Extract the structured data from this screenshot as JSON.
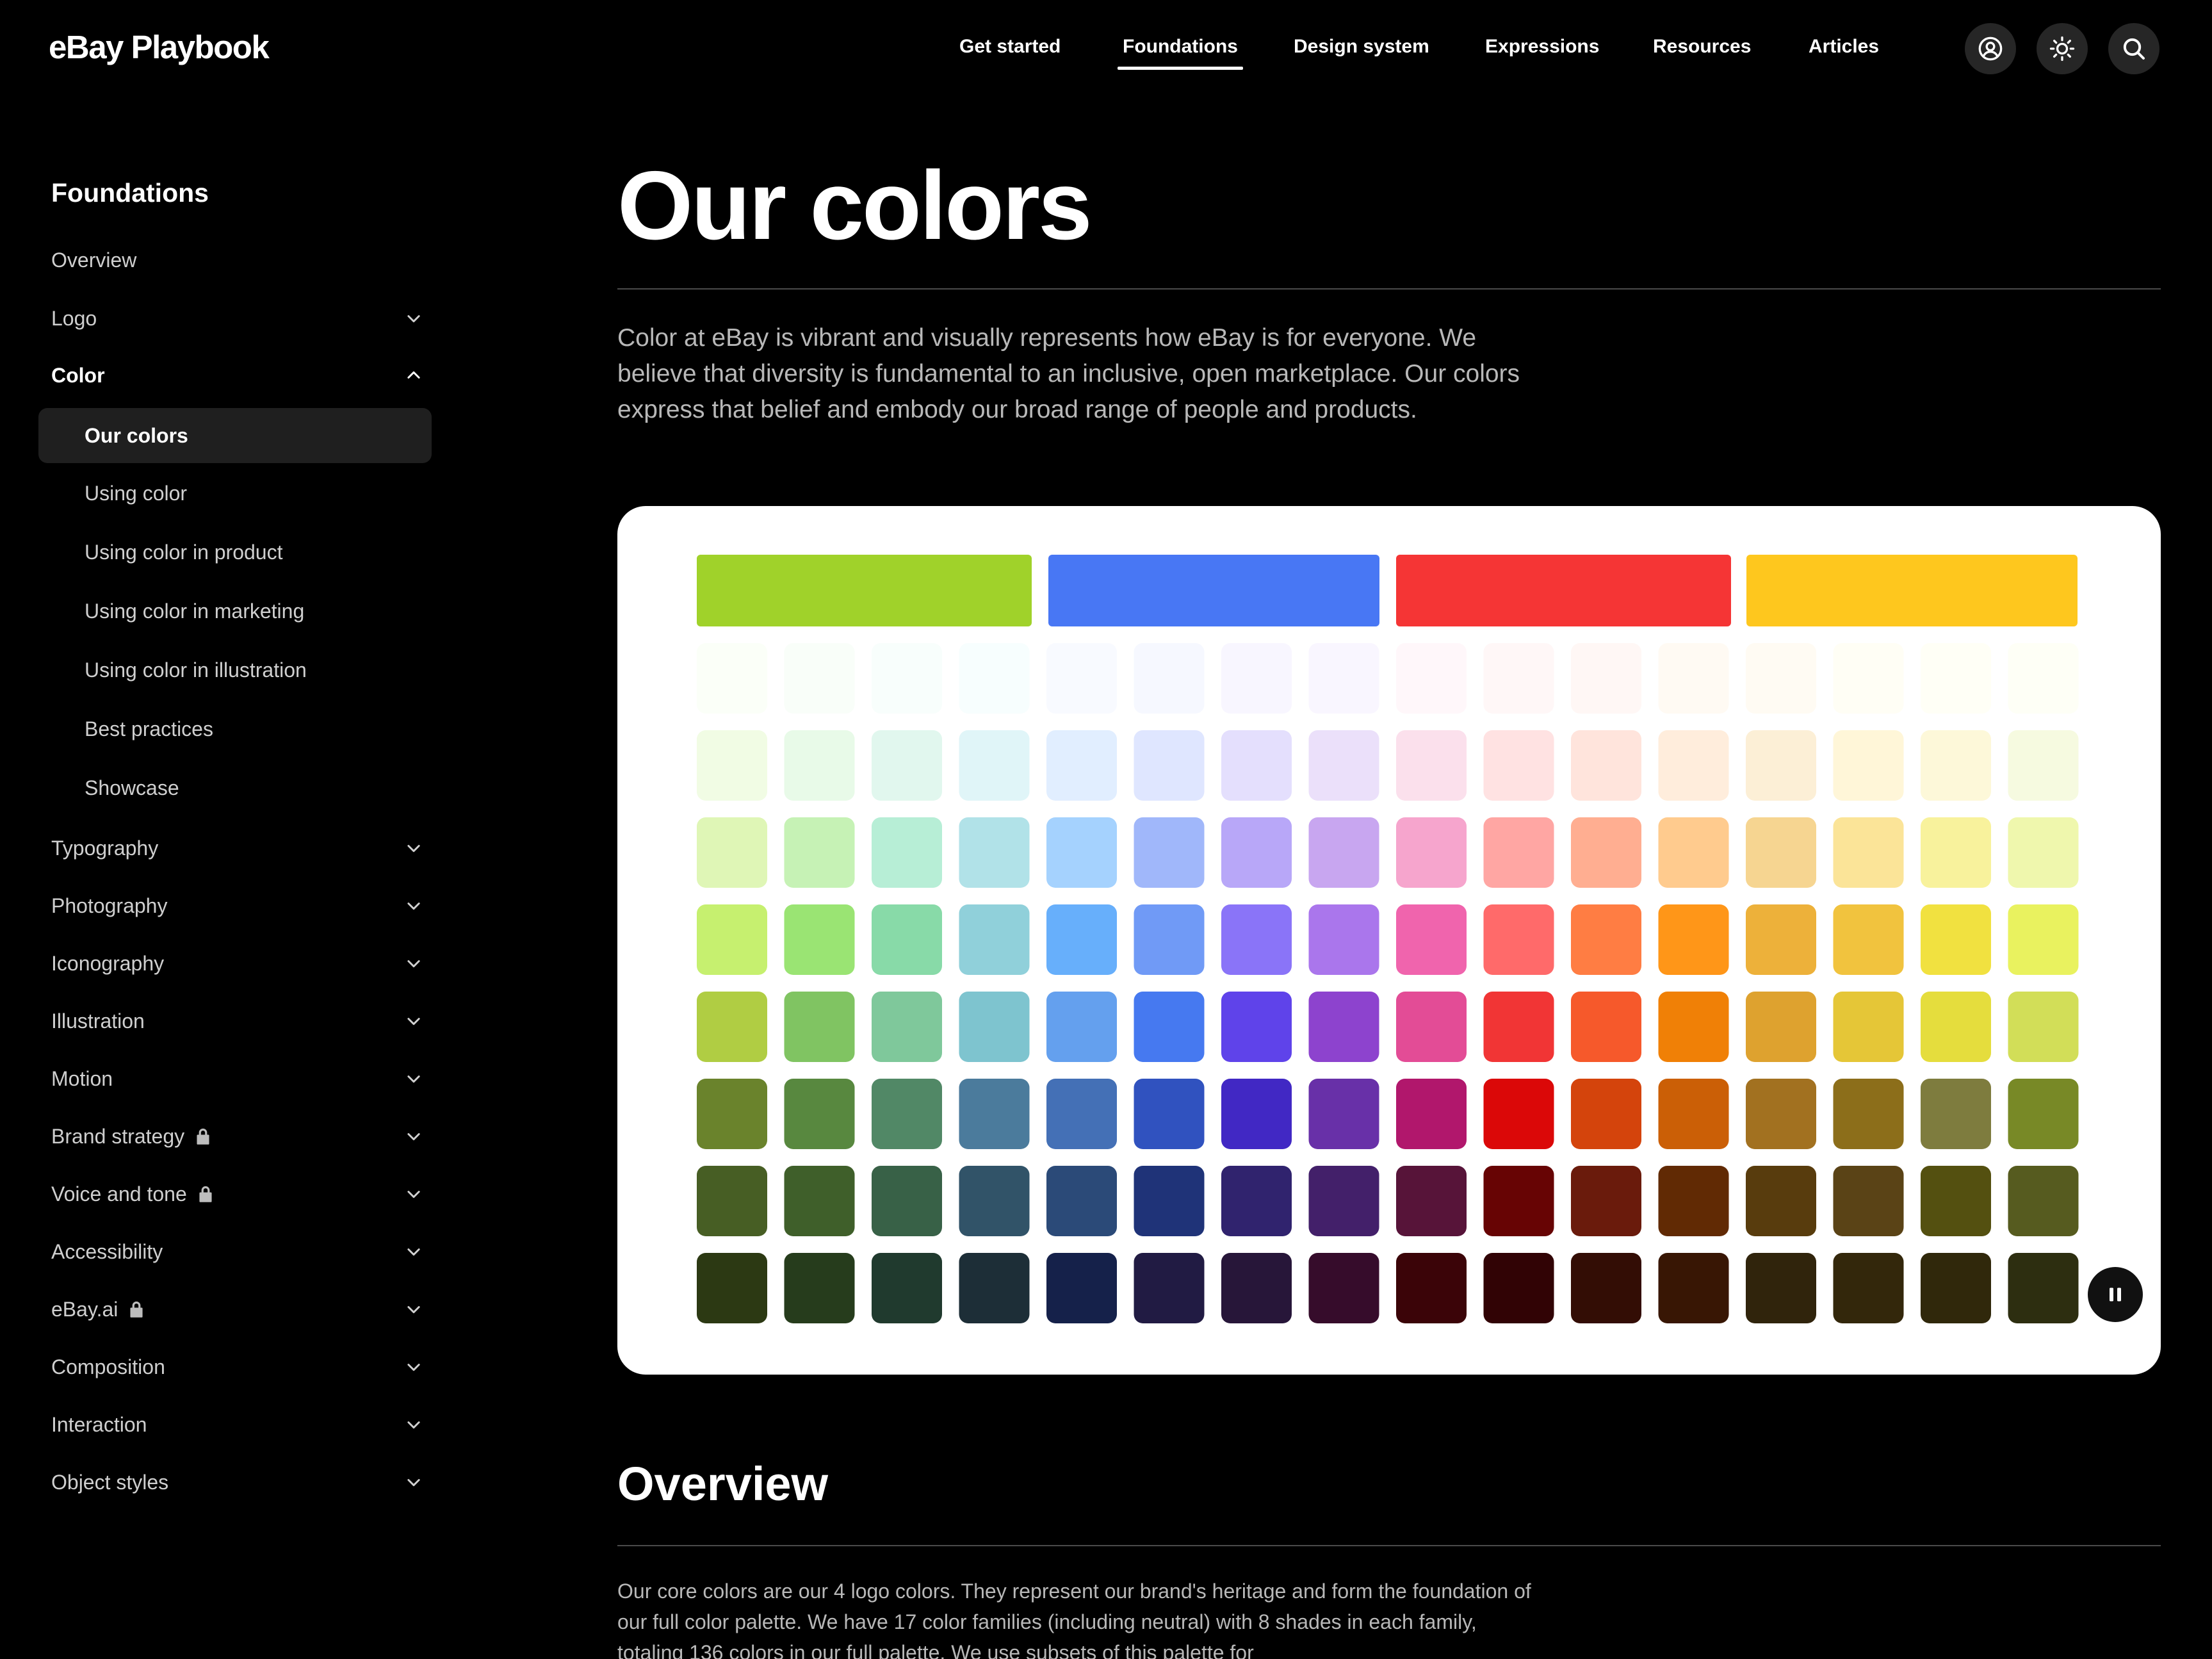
{
  "header": {
    "logo": "eBay Playbook",
    "nav": [
      {
        "label": "Get started",
        "active": false
      },
      {
        "label": "Foundations",
        "active": true
      },
      {
        "label": "Design system",
        "active": false
      },
      {
        "label": "Expressions",
        "active": false
      },
      {
        "label": "Resources",
        "active": false
      },
      {
        "label": "Articles",
        "active": false
      }
    ],
    "icons": [
      "user-icon",
      "sun-icon",
      "search-icon"
    ]
  },
  "sidebar": {
    "title": "Foundations",
    "items": [
      {
        "label": "Overview"
      },
      {
        "label": "Logo",
        "chevron": "down"
      },
      {
        "label": "Color",
        "chevron": "up",
        "expanded": true
      },
      {
        "label": "Typography",
        "chevron": "down"
      },
      {
        "label": "Photography",
        "chevron": "down"
      },
      {
        "label": "Iconography",
        "chevron": "down"
      },
      {
        "label": "Illustration",
        "chevron": "down"
      },
      {
        "label": "Motion",
        "chevron": "down"
      },
      {
        "label": "Brand strategy",
        "chevron": "down",
        "locked": true
      },
      {
        "label": "Voice and tone",
        "chevron": "down",
        "locked": true
      },
      {
        "label": "Accessibility",
        "chevron": "down"
      },
      {
        "label": "eBay.ai",
        "chevron": "down",
        "locked": true
      },
      {
        "label": "Composition",
        "chevron": "down"
      },
      {
        "label": "Interaction",
        "chevron": "down"
      },
      {
        "label": "Object styles",
        "chevron": "down"
      }
    ],
    "color_subitems": [
      {
        "label": "Our colors",
        "active": true
      },
      {
        "label": "Using color"
      },
      {
        "label": "Using color in product"
      },
      {
        "label": "Using color in marketing"
      },
      {
        "label": "Using color in illustration"
      },
      {
        "label": "Best practices"
      },
      {
        "label": "Showcase"
      }
    ]
  },
  "main": {
    "title": "Our colors",
    "intro": "Color at eBay is vibrant and visually represents how eBay is for everyone. We believe that diversity is fundamental to an inclusive, open marketplace. Our colors express that belief and embody our broad range of people and products.",
    "overview_title": "Overview",
    "overview_text": "Our core colors are our 4 logo colors. They represent our brand's heritage and form the foundation of our full color palette. We have 17 color families (including neutral) with 8 shades in each family, totaling 136 colors in our full palette. We use subsets of this palette for"
  },
  "palette": {
    "core_colors": [
      "#A0D22A",
      "#4877F4",
      "#F53535",
      "#FEC71E"
    ],
    "rows": [
      [
        "#FBFFF8",
        "#F9FEF9",
        "#F8FEFC",
        "#F7FEFE",
        "#F8FAFF",
        "#F6F8FF",
        "#F8F6FF",
        "#F9F6FF",
        "#FFF7FA",
        "#FFF7F7",
        "#FFF7F5",
        "#FFFAF3",
        "#FFFBF3",
        "#FFFEF5",
        "#FFFFF6",
        "#FEFFF6"
      ],
      [
        "#F1FCE4",
        "#E8FAE8",
        "#E1F7EE",
        "#E0F5F8",
        "#E1EEFF",
        "#DFE6FF",
        "#E4DFFD",
        "#EBE0FA",
        "#FBE0EC",
        "#FFE2E2",
        "#FFE4DC",
        "#FFEDDC",
        "#FCEFD6",
        "#FFF6D8",
        "#FDF8D9",
        "#F6FAE0"
      ],
      [
        "#DFF6B6",
        "#C6F2B5",
        "#B7EED6",
        "#B1E2E8",
        "#A5D2FE",
        "#A0B7FA",
        "#B8A7F8",
        "#C8A6F0",
        "#F6A5CD",
        "#FFA6A3",
        "#FFAE91",
        "#FFCB8E",
        "#F6D591",
        "#FBE498",
        "#F8F29C",
        "#EFF7AD"
      ],
      [
        "#C6F06F",
        "#9AE473",
        "#88DAA8",
        "#90D0DA",
        "#67AFFB",
        "#709AF6",
        "#8A74F8",
        "#AA76EC",
        "#F064AD",
        "#FF6A6A",
        "#FF7D43",
        "#FF9618",
        "#EDB13A",
        "#F1C33E",
        "#F1E140",
        "#E9F25F"
      ],
      [
        "#B0CD43",
        "#80C462",
        "#7FC89B",
        "#7EC4CF",
        "#64A0EE",
        "#4679F0",
        "#5F43EA",
        "#8D43CE",
        "#E34C96",
        "#F13535",
        "#F6592B",
        "#F08006",
        "#DEA22F",
        "#E5C637",
        "#E5DD3D",
        "#D2DE58"
      ],
      [
        "#6A832C",
        "#58883F",
        "#518866",
        "#4B7B9C",
        "#4470B6",
        "#3052BF",
        "#4128C4",
        "#6830A8",
        "#B1176C",
        "#DB0808",
        "#D4440C",
        "#CB5F06",
        "#A27120",
        "#8C6E1A",
        "#7E7C3E",
        "#788926"
      ],
      [
        "#475E24",
        "#3F5F2A",
        "#386147",
        "#315368",
        "#2B4A78",
        "#1F3378",
        "#30236E",
        "#43206A",
        "#571439",
        "#670404",
        "#6A1B0C",
        "#612A04",
        "#583C0D",
        "#5A4316",
        "#545010",
        "#565B1F"
      ],
      [
        "#2C3913",
        "#263C1C",
        "#203A2E",
        "#1D2E37",
        "#15214A",
        "#211B43",
        "#271639",
        "#360C2B",
        "#3B0408",
        "#310305",
        "#330D05",
        "#381604",
        "#30240C",
        "#33270B",
        "#30280B",
        "#2D2E10"
      ]
    ]
  }
}
